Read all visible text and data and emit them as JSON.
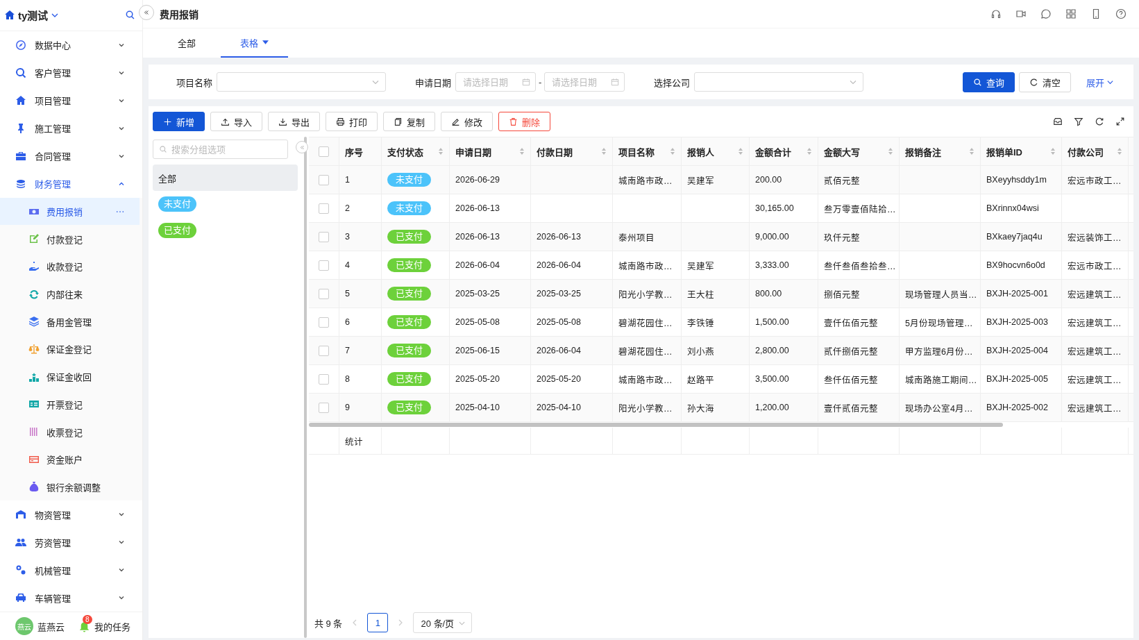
{
  "sidebar": {
    "brand": "ty测试",
    "menu": [
      {
        "label": "数据中心",
        "expanded": false
      },
      {
        "label": "客户管理",
        "expanded": false
      },
      {
        "label": "项目管理",
        "expanded": false
      },
      {
        "label": "施工管理",
        "expanded": false
      },
      {
        "label": "合同管理",
        "expanded": false
      },
      {
        "label": "财务管理",
        "expanded": true,
        "children": [
          {
            "label": "费用报销",
            "selected": true
          },
          {
            "label": "付款登记",
            "selected": false
          },
          {
            "label": "收款登记",
            "selected": false
          },
          {
            "label": "内部往来",
            "selected": false
          },
          {
            "label": "备用金管理",
            "selected": false
          },
          {
            "label": "保证金登记",
            "selected": false
          },
          {
            "label": "保证金收回",
            "selected": false
          },
          {
            "label": "开票登记",
            "selected": false
          },
          {
            "label": "收票登记",
            "selected": false
          },
          {
            "label": "资金账户",
            "selected": false
          },
          {
            "label": "银行余额调整",
            "selected": false
          }
        ]
      },
      {
        "label": "物资管理",
        "expanded": false
      },
      {
        "label": "劳资管理",
        "expanded": false
      },
      {
        "label": "机械管理",
        "expanded": false
      },
      {
        "label": "车辆管理",
        "expanded": false
      }
    ],
    "footer": {
      "avatar": "燕云",
      "user": "蓝燕云",
      "tasks": "我的任务",
      "badge": "8"
    }
  },
  "header": {
    "title": "费用报销"
  },
  "tabs": [
    {
      "label": "全部",
      "selected": false
    },
    {
      "label": "表格",
      "selected": true
    }
  ],
  "filters": [
    {
      "kind": "select",
      "label": "项目名称"
    },
    {
      "kind": "daterange",
      "label": "申请日期",
      "placeholder_start": "请选择日期",
      "separator": "-",
      "placeholder_end": "请选择日期"
    },
    {
      "kind": "select",
      "label": "选择公司"
    }
  ],
  "filter_buttons": {
    "search": "查询",
    "clear": "清空",
    "expand": "展开"
  },
  "toolbar": [
    {
      "label": "新增",
      "kind": "primary"
    },
    {
      "label": "导入",
      "kind": "default"
    },
    {
      "label": "导出",
      "kind": "default"
    },
    {
      "label": "打印",
      "kind": "default"
    },
    {
      "label": "复制",
      "kind": "default"
    },
    {
      "label": "修改",
      "kind": "default"
    },
    {
      "label": "删除",
      "kind": "danger"
    }
  ],
  "groups": {
    "placeholder": "搜索分组选项",
    "items": [
      {
        "label": "全部",
        "kind": "plain",
        "selected": true
      },
      {
        "label": "未支付",
        "kind": "tag",
        "selected": false,
        "color": "#4cc3fa"
      },
      {
        "label": "已支付",
        "kind": "tag",
        "selected": false,
        "color": "#6dd13b"
      }
    ]
  },
  "table": {
    "header_checked": false,
    "columns": [
      {
        "label": "序号",
        "sortable": false
      },
      {
        "label": "支付状态",
        "sortable": true
      },
      {
        "label": "申请日期",
        "sortable": true
      },
      {
        "label": "付款日期",
        "sortable": true
      },
      {
        "label": "项目名称",
        "sortable": true
      },
      {
        "label": "报销人",
        "sortable": true
      },
      {
        "label": "金额合计",
        "sortable": true
      },
      {
        "label": "金额大写",
        "sortable": true
      },
      {
        "label": "报销备注",
        "sortable": true
      },
      {
        "label": "报销单ID",
        "sortable": true
      },
      {
        "label": "付款公司",
        "sortable": true
      }
    ],
    "rows": [
      {
        "checked": false,
        "cells": [
          "1",
          {
            "text": "未支付",
            "color": "#4cc3fa"
          },
          "2026-06-29",
          "",
          "城南路市政…",
          "吴建军",
          "200.00",
          "贰佰元整",
          "",
          "BXeyyhsddy1m",
          "宏远市政工…"
        ]
      },
      {
        "checked": false,
        "cells": [
          "2",
          {
            "text": "未支付",
            "color": "#4cc3fa"
          },
          "2026-06-13",
          "",
          "",
          "",
          "30,165.00",
          "叁万零壹佰陆拾…",
          "",
          "BXrinnx04wsi",
          ""
        ]
      },
      {
        "checked": false,
        "cells": [
          "3",
          {
            "text": "已支付",
            "color": "#6dd13b"
          },
          "2026-06-13",
          "2026-06-13",
          "泰州项目",
          "",
          "9,000.00",
          "玖仟元整",
          "",
          "BXkaey7jaq4u",
          "宏远装饰工…"
        ]
      },
      {
        "checked": false,
        "cells": [
          "4",
          {
            "text": "已支付",
            "color": "#6dd13b"
          },
          "2026-06-04",
          "2026-06-04",
          "城南路市政…",
          "吴建军",
          "3,333.00",
          "叁仟叁佰叁拾叁…",
          "",
          "BX9hocvn6o0d",
          "宏远市政工…"
        ]
      },
      {
        "checked": false,
        "cells": [
          "5",
          {
            "text": "已支付",
            "color": "#6dd13b"
          },
          "2025-03-25",
          "2025-03-25",
          "阳光小学教…",
          "王大柱",
          "800.00",
          "捌佰元整",
          "现场管理人员当…",
          "BXJH-2025-001",
          "宏远建筑工…"
        ]
      },
      {
        "checked": false,
        "cells": [
          "6",
          {
            "text": "已支付",
            "color": "#6dd13b"
          },
          "2025-05-08",
          "2025-05-08",
          "碧湖花园住…",
          "李铁锤",
          "1,500.00",
          "壹仟伍佰元整",
          "5月份现场管理…",
          "BXJH-2025-003",
          "宏远建筑工…"
        ]
      },
      {
        "checked": false,
        "cells": [
          "7",
          {
            "text": "已支付",
            "color": "#6dd13b"
          },
          "2025-06-15",
          "2026-06-04",
          "碧湖花园住…",
          "刘小燕",
          "2,800.00",
          "贰仟捌佰元整",
          "甲方监理6月份…",
          "BXJH-2025-004",
          "宏远建筑工…"
        ]
      },
      {
        "checked": false,
        "cells": [
          "8",
          {
            "text": "已支付",
            "color": "#6dd13b"
          },
          "2025-05-20",
          "2025-05-20",
          "城南路市政…",
          "赵路平",
          "3,500.00",
          "叁仟伍佰元整",
          "城南路施工期间…",
          "BXJH-2025-005",
          "宏远建筑工…"
        ]
      },
      {
        "checked": false,
        "cells": [
          "9",
          {
            "text": "已支付",
            "color": "#6dd13b"
          },
          "2025-04-10",
          "2025-04-10",
          "阳光小学教…",
          "孙大海",
          "1,200.00",
          "壹仟贰佰元整",
          "现场办公室4月…",
          "BXJH-2025-002",
          "宏远建筑工…"
        ]
      }
    ],
    "summary_label": "统计"
  },
  "pagination": {
    "total": "共 9 条",
    "pages": [
      {
        "label": "1",
        "selected": true
      }
    ],
    "page_size": "20 条/页"
  }
}
